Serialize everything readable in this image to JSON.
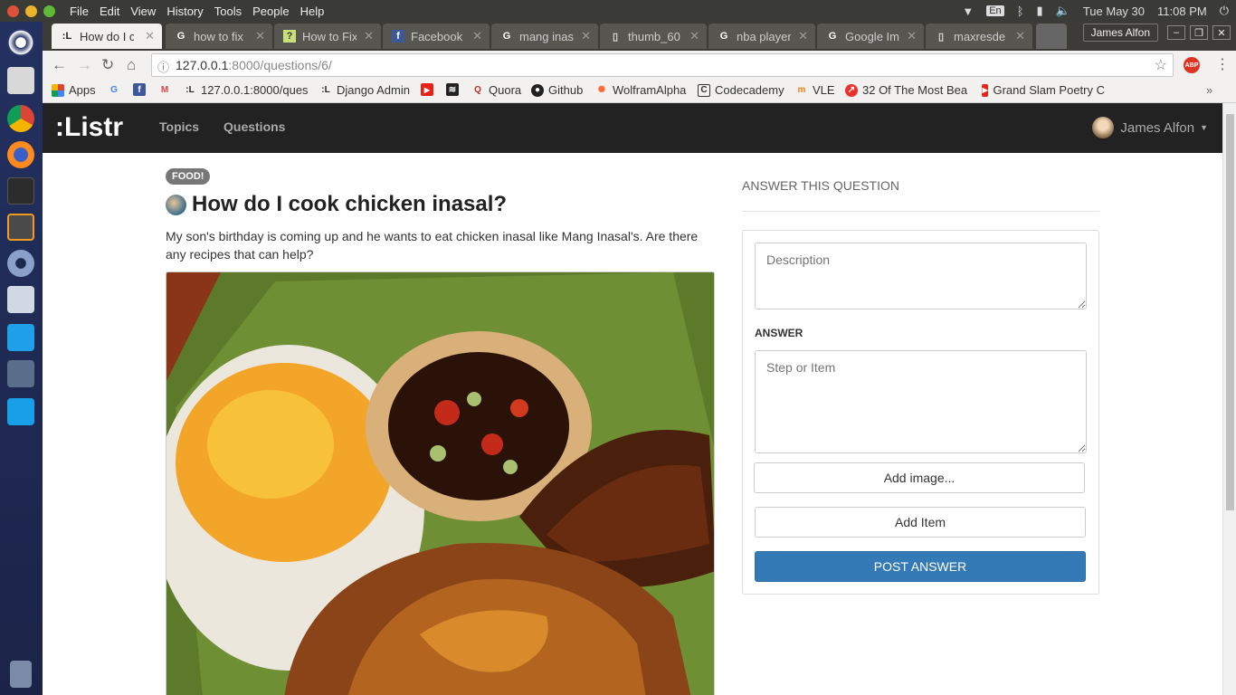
{
  "system": {
    "menus": [
      "File",
      "Edit",
      "View",
      "History",
      "Tools",
      "People",
      "Help"
    ],
    "keyboard": "En",
    "datetime": "Tue May 30",
    "time": "11:08 PM"
  },
  "browser": {
    "profile": "James Alfon",
    "tabs": [
      {
        "label": "How do I c",
        "icon": "listr-favicon"
      },
      {
        "label": "how to fix",
        "icon": "google-favicon"
      },
      {
        "label": "How to Fix",
        "icon": "question-favicon"
      },
      {
        "label": "Facebook",
        "icon": "facebook-favicon"
      },
      {
        "label": "mang inas",
        "icon": "google-favicon"
      },
      {
        "label": "thumb_60",
        "icon": "page-favicon"
      },
      {
        "label": "nba player",
        "icon": "google-favicon"
      },
      {
        "label": "Google Im",
        "icon": "google-favicon"
      },
      {
        "label": "maxresde",
        "icon": "page-favicon"
      }
    ],
    "url_host": "127.0.0.1",
    "url_rest": ":8000/questions/6/",
    "bookmarks": [
      {
        "label": "Apps",
        "icon": "apps-icon"
      },
      {
        "label": "",
        "icon": "google-icon"
      },
      {
        "label": "",
        "icon": "facebook-icon"
      },
      {
        "label": "",
        "icon": "gmail-icon"
      },
      {
        "label": "127.0.0.1:8000/ques",
        "icon": "listr-icon"
      },
      {
        "label": "Django Admin",
        "icon": "listr-icon"
      },
      {
        "label": "",
        "icon": "youtube-icon"
      },
      {
        "label": "",
        "icon": "pocket-icon"
      },
      {
        "label": "Quora",
        "icon": "quora-icon"
      },
      {
        "label": "Github",
        "icon": "github-icon"
      },
      {
        "label": "WolframAlpha",
        "icon": "wolfram-icon"
      },
      {
        "label": "Codecademy",
        "icon": "codecademy-icon"
      },
      {
        "label": "VLE",
        "icon": "moodle-icon"
      },
      {
        "label": "32 Of The Most Bea",
        "icon": "trending-icon"
      },
      {
        "label": "Grand Slam Poetry C",
        "icon": "youtube-icon"
      }
    ]
  },
  "site": {
    "brand": ":Listr",
    "nav": [
      "Topics",
      "Questions"
    ],
    "user": "James Alfon"
  },
  "question": {
    "tag": "FOOD!",
    "title": "How do I cook chicken inasal?",
    "description": "My son's birthday is coming up and he wants to eat chicken inasal like Mang Inasal's. Are there any recipes that can help?"
  },
  "answer_form": {
    "heading": "ANSWER THIS QUESTION",
    "description_placeholder": "Description",
    "answer_label": "ANSWER",
    "step_placeholder": "Step or Item",
    "add_image": "Add image...",
    "add_item": "Add Item",
    "post": "POST ANSWER"
  },
  "colors": {
    "primary": "#337ab7",
    "navbar": "#222222",
    "badge": "#777777"
  }
}
